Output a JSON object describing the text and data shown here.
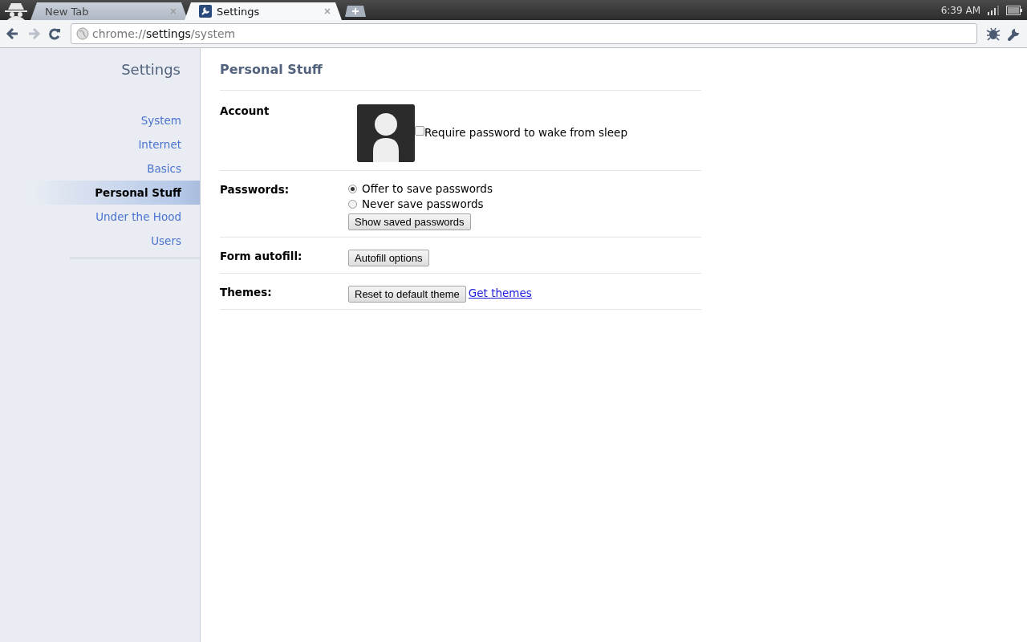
{
  "browser": {
    "tabs": [
      {
        "title": "New Tab",
        "selected": false
      },
      {
        "title": "Settings",
        "selected": true
      }
    ],
    "address": "chrome://**settings**/system",
    "status": {
      "time": "6:39 AM"
    }
  },
  "sidebar": {
    "title": "Settings",
    "items": [
      {
        "label": "System",
        "selected": false
      },
      {
        "label": "Internet",
        "selected": false
      },
      {
        "label": "Basics",
        "selected": false
      },
      {
        "label": "Personal Stuff",
        "selected": true
      },
      {
        "label": "Under the Hood",
        "selected": false
      },
      {
        "label": "Users",
        "selected": false
      }
    ]
  },
  "section": {
    "title": "Personal Stuff",
    "rows": [
      {
        "label": "Account",
        "controls": [
          {
            "kind": "avatar"
          },
          {
            "kind": "checkbox",
            "label": "Require password to wake from sleep",
            "checked": false
          }
        ]
      },
      {
        "label": "Passwords:",
        "controls": [
          {
            "kind": "radio",
            "label": "Offer to save passwords",
            "selected": true
          },
          {
            "kind": "radio",
            "label": "Never save passwords",
            "selected": false
          },
          {
            "kind": "button",
            "label": "Show saved passwords"
          }
        ]
      },
      {
        "label": "Form autofill:",
        "controls": [
          {
            "kind": "button",
            "label": "Autofill options"
          }
        ]
      },
      {
        "label": "Themes:",
        "controls": [
          {
            "kind": "button",
            "label": "Reset to default theme"
          },
          {
            "kind": "link",
            "label": "Get themes"
          }
        ]
      }
    ]
  }
}
